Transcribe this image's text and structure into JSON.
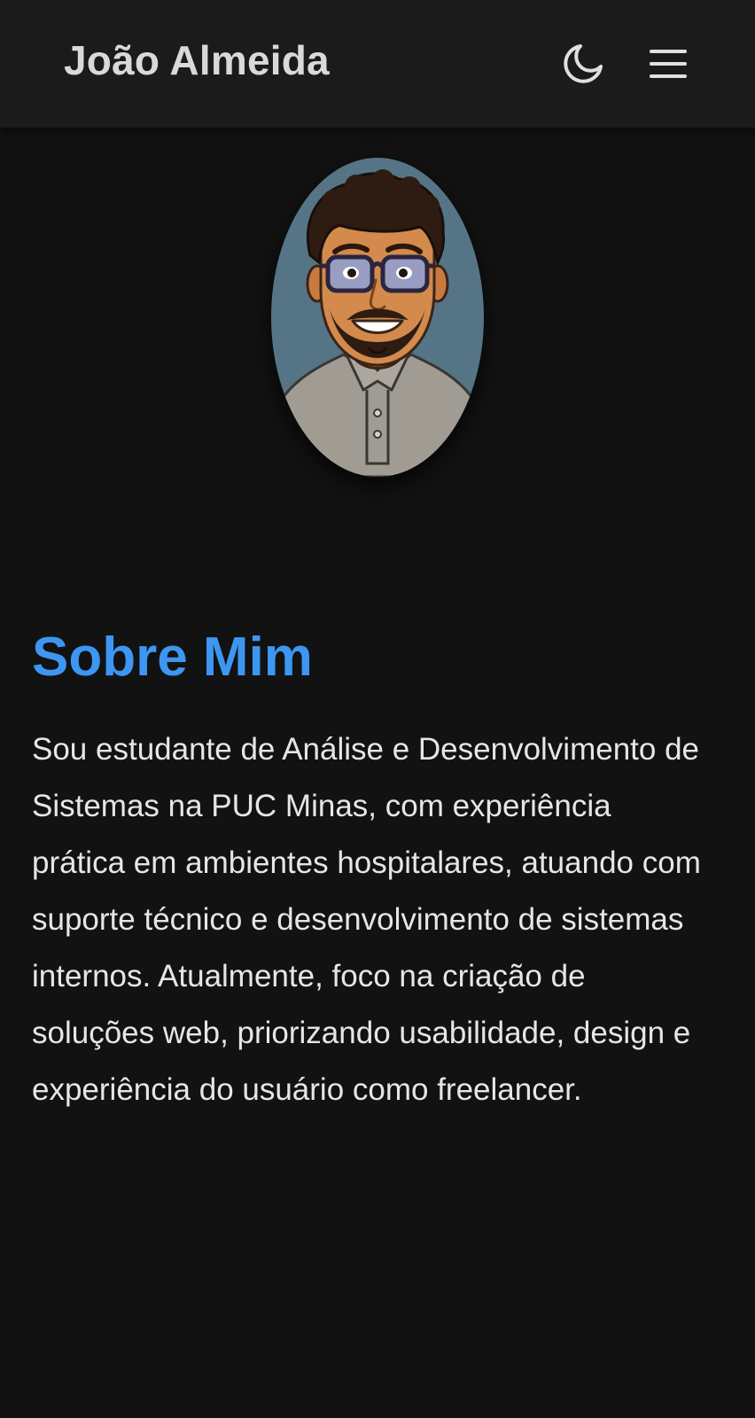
{
  "header": {
    "title": "João Almeida",
    "theme_toggle_icon": "moon-icon",
    "menu_icon": "hamburger-menu-icon"
  },
  "profile": {
    "avatar": "avatar-illustration"
  },
  "about": {
    "title": "Sobre Mim",
    "text": "Sou estudante de Análise e Desenvolvimento de Sistemas na PUC Minas, com experiência prática em ambientes hospitalares, atuando com suporte técnico e desenvolvimento de sistemas internos. Atualmente, foco na criação de soluções web, priorizando usabilidade, design e experiência do usuário como freelancer."
  },
  "colors": {
    "background": "#121212",
    "header": "#1b1b1b",
    "accent": "#3d97f2",
    "text": "#e6e6e6"
  }
}
